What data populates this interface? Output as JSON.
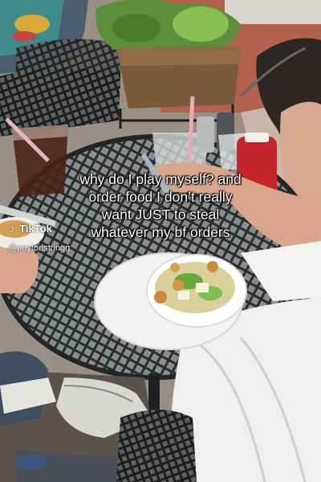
{
  "caption": {
    "lines": [
      "why do I play myself? and",
      "order food I don’t really",
      "want JUST to steal",
      "whatever my bf orders"
    ]
  },
  "watermark": {
    "logo_text": "TikTok",
    "logo_icon": "tiktok-note-icon",
    "username": "@peytonstringg"
  },
  "colors": {
    "table_metal": "#232628",
    "brick": "#b2614f",
    "plate": "#f2f2f0",
    "foliage": "#5d8f3a"
  }
}
